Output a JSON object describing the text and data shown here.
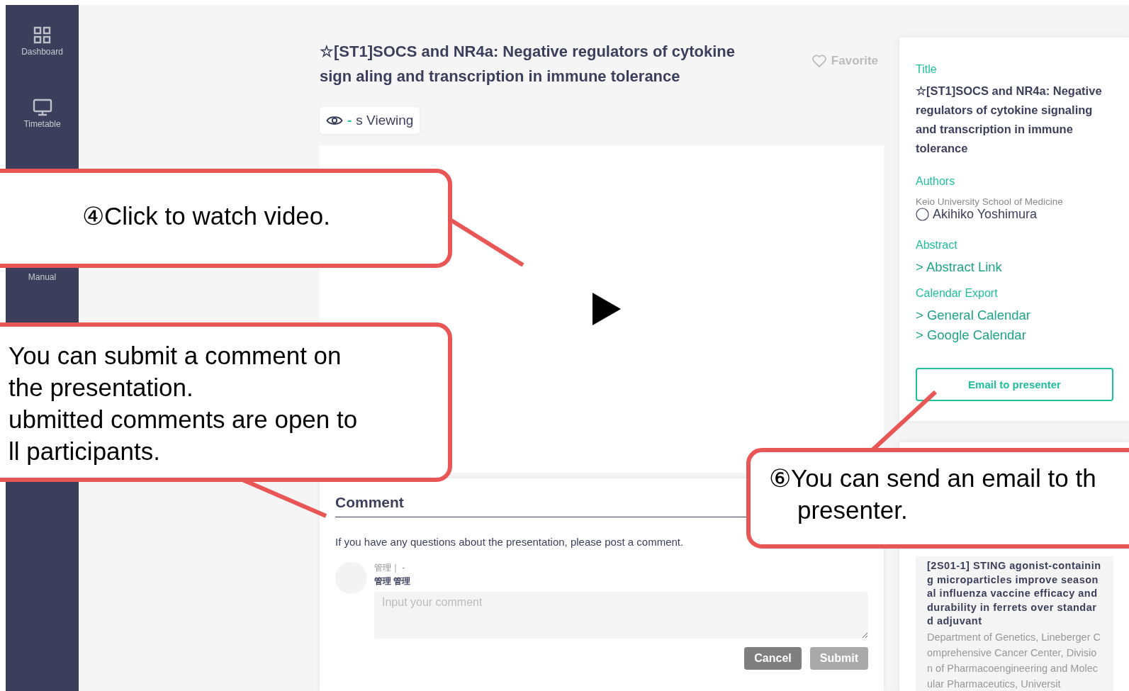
{
  "sidebar": {
    "items": [
      {
        "label": "Dashboard",
        "kind": "grid"
      },
      {
        "label": "Timetable",
        "kind": "monitor"
      },
      {
        "label": "Manual",
        "kind": "hidden"
      }
    ]
  },
  "presentation": {
    "title": "☆[ST1]SOCS and NR4a: Negative regulators of cytokine sign aling and transcription in immune tolerance",
    "favorite": {
      "label": "Favorite",
      "selected": false
    },
    "viewers": {
      "count": "-",
      "label": "s Viewing"
    }
  },
  "comment": {
    "heading": "Comment",
    "hint": "If you have any questions about the presentation, please post a comment.",
    "user": {
      "meta": "管理｜ -",
      "name": "管理 管理"
    },
    "placeholder": "Input your comment",
    "buttons": [
      {
        "label": "Cancel",
        "disabled": false
      },
      {
        "label": "Submit",
        "disabled": true
      }
    ]
  },
  "details": {
    "title_label": "Title",
    "title": "☆[ST1]SOCS and NR4a: Negative regulators of cytokine signaling and transcription in immune tolerance",
    "authors_label": "Authors",
    "affiliation": "Keio University School of Medicine",
    "author": "Akihiko Yoshimura",
    "abstract_label": "Abstract",
    "abstract_link": "> Abstract Link",
    "calendar_label": "Calendar Export",
    "calendar_links": [
      "> General Calendar",
      "> Google Calendar"
    ],
    "email_button": "Email to presenter"
  },
  "related": {
    "title": "[2S01-1] STING agonist-containing microparticles improve seasonal influenza vaccine efficacy and durability in ferrets over standard adjuvant",
    "affiliation": "Department of Genetics, Lineberger Comprehensive Cancer Center, Division of Pharmacoengineering and Molecular Pharmaceutics, Universit"
  },
  "callouts": [
    {
      "lines": [
        "④Click to watch video."
      ]
    },
    {
      "lines": [
        "You can submit a comment on",
        "the presentation.",
        "ubmitted comments are open to",
        "ll participants."
      ]
    },
    {
      "lines": [
        "⑥You can send an email to th",
        "presenter."
      ]
    }
  ]
}
